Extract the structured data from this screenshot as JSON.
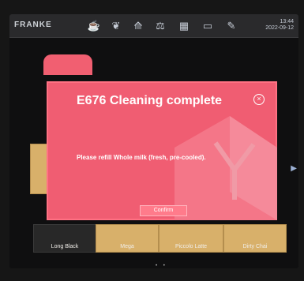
{
  "topbar": {
    "brand": "FRANKE",
    "icons": [
      {
        "name": "cup-icon",
        "glyph": "☕",
        "active": true
      },
      {
        "name": "leaf-icon",
        "glyph": "❦",
        "active": false
      },
      {
        "name": "tray-icon",
        "glyph": "⟰",
        "active": false
      },
      {
        "name": "scale-icon",
        "glyph": "⚖",
        "active": false
      },
      {
        "name": "grid-icon",
        "glyph": "▦",
        "active": false
      },
      {
        "name": "tablet-icon",
        "glyph": "▭",
        "active": false
      },
      {
        "name": "wrench-icon",
        "glyph": "✎",
        "active": false
      }
    ],
    "time": "13:44",
    "date": "2022-09-12"
  },
  "tiles": {
    "long_black": "Long Black",
    "mega": "Mega",
    "piccolo_latte": "Piccolo Latte",
    "dirty_chai": "Dirty Chai"
  },
  "pager": "• •",
  "modal": {
    "title": "E676 Cleaning complete",
    "message": "Please refill Whole milk (fresh, pre-cooled).",
    "confirm_label": "Confirm",
    "close_icon": "close-icon",
    "accent": "#f05d72"
  }
}
